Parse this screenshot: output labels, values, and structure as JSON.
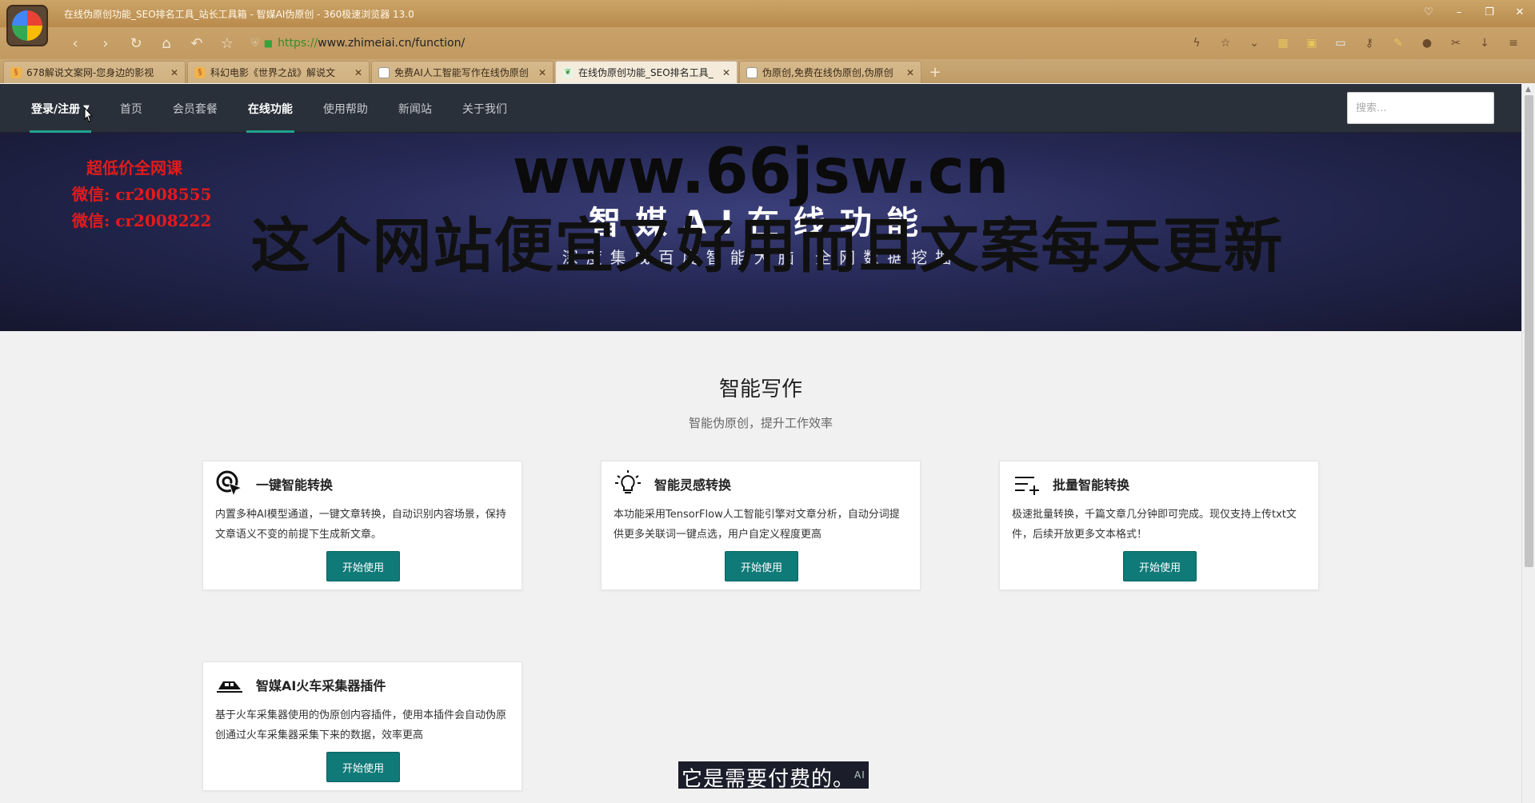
{
  "browser": {
    "window_title": "在线伪原创功能_SEO排名工具_站长工具箱 - 智媒AI伪原创 - 360极速浏览器 13.0",
    "url_scheme": "https://",
    "url_rest": "www.zhimeiai.cn/function/",
    "tabs": [
      {
        "label": "678解说文案网-您身边的影视",
        "icon": "book-icon",
        "active": false
      },
      {
        "label": "科幻电影《世界之战》解说文",
        "icon": "book-icon",
        "active": false
      },
      {
        "label": "免费AI人工智能写作在线伪原创",
        "icon": "page-icon",
        "active": false
      },
      {
        "label": "在线伪原创功能_SEO排名工具_",
        "icon": "leaf-icon",
        "active": true
      },
      {
        "label": "伪原创,免费在线伪原创,伪原创",
        "icon": "page-icon",
        "active": false
      }
    ]
  },
  "site_nav": {
    "items": [
      {
        "label": "登录/注册",
        "key": "login"
      },
      {
        "label": "首页",
        "key": "home"
      },
      {
        "label": "会员套餐",
        "key": "vip"
      },
      {
        "label": "在线功能",
        "key": "functions"
      },
      {
        "label": "使用帮助",
        "key": "help"
      },
      {
        "label": "新闻站",
        "key": "news"
      },
      {
        "label": "关于我们",
        "key": "about"
      }
    ],
    "search_placeholder": "搜索..."
  },
  "banner": {
    "title": "智媒AI在线功能",
    "subtitle": "深度集成百度智能大脑·全网数据挖掘"
  },
  "watermark": {
    "url": "www.66jsw.cn",
    "slogan": "这个网站便宜又好用而且文案每天更新",
    "red_lines": [
      "超低价全网课",
      "微信: cr2008555",
      "微信: cr2008222"
    ]
  },
  "section": {
    "title": "智能写作",
    "subtitle": "智能伪原创，提升工作效率"
  },
  "cards": [
    {
      "title": "一键智能转换",
      "icon": "target-cursor-icon",
      "desc": "内置多种AI模型通道，一键文章转换，自动识别内容场景，保持文章语义不变的前提下生成新文章。",
      "button": "开始使用"
    },
    {
      "title": "智能灵感转换",
      "icon": "lightbulb-icon",
      "desc": "本功能采用TensorFlow人工智能引擎对文章分析，自动分词提供更多关联词一键点选，用户自定义程度更高",
      "button": "开始使用"
    },
    {
      "title": "批量智能转换",
      "icon": "list-add-icon",
      "desc": "极速批量转换，千篇文章几分钟即可完成。现仅支持上传txt文件，后续开放更多文本格式！",
      "button": "开始使用"
    },
    {
      "title": "智媒AI火车采集器插件",
      "icon": "train-icon",
      "desc": "基于火车采集器使用的伪原创内容插件，使用本插件会自动伪原创通过火车采集器采集下来的数据，效率更高",
      "button": "开始使用"
    }
  ],
  "caption": {
    "text": "它是需要付费的。",
    "tag": "AI"
  }
}
